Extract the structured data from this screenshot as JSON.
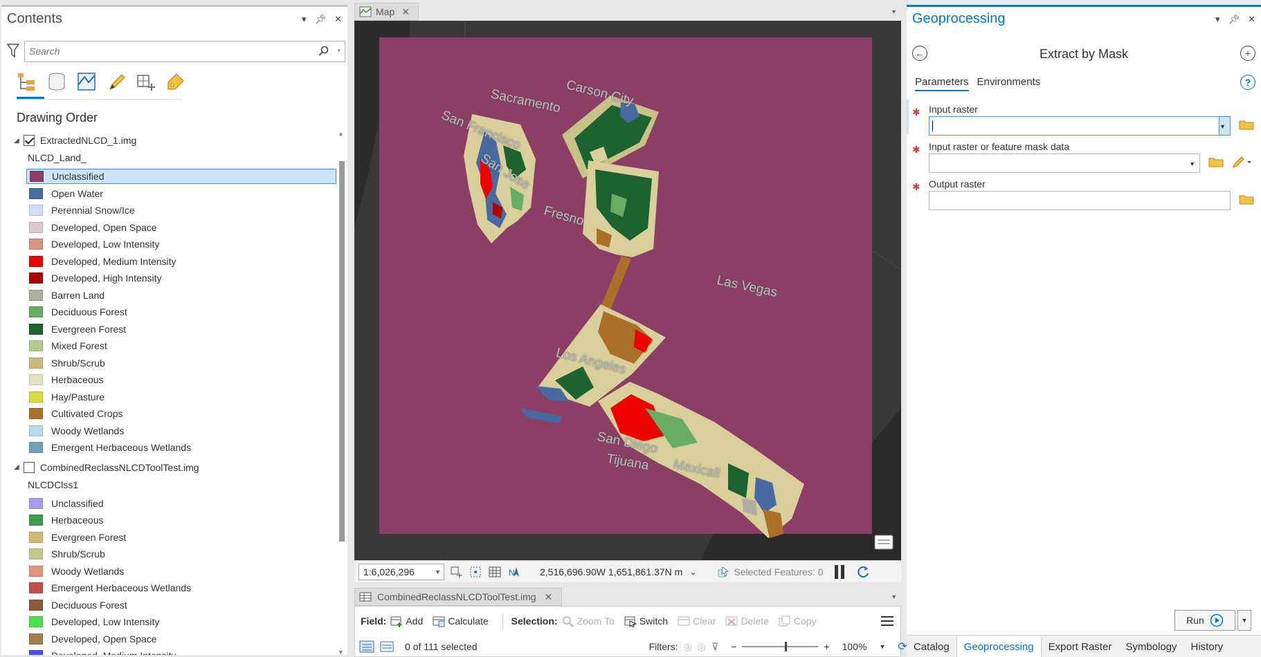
{
  "contents": {
    "title": "Contents",
    "search_placeholder": "Search",
    "section_title": "Drawing Order",
    "layer1": {
      "name": "ExtractedNLCD_1.img",
      "checked": true,
      "field": "NLCD_Land_",
      "classes": [
        {
          "label": "Unclassified",
          "color": "#8b3f65",
          "selected": true
        },
        {
          "label": "Open Water",
          "color": "#476ba1"
        },
        {
          "label": "Perennial Snow/Ice",
          "color": "#d1ddf9"
        },
        {
          "label": "Developed, Open Space",
          "color": "#ddc9c9"
        },
        {
          "label": "Developed, Low Intensity",
          "color": "#d89382"
        },
        {
          "label": "Developed, Medium Intensity",
          "color": "#ed0000"
        },
        {
          "label": "Developed, High Intensity",
          "color": "#aa0000"
        },
        {
          "label": "Barren Land",
          "color": "#b2ada3"
        },
        {
          "label": "Deciduous Forest",
          "color": "#68ab63"
        },
        {
          "label": "Evergreen Forest",
          "color": "#1c6330"
        },
        {
          "label": "Mixed Forest",
          "color": "#b5c98e"
        },
        {
          "label": "Shrub/Scrub",
          "color": "#ccba7d"
        },
        {
          "label": "Herbaceous",
          "color": "#e3e3c2"
        },
        {
          "label": "Hay/Pasture",
          "color": "#dcd93d"
        },
        {
          "label": "Cultivated Crops",
          "color": "#ab7028"
        },
        {
          "label": "Woody Wetlands",
          "color": "#bad9eb"
        },
        {
          "label": "Emergent Herbaceous Wetlands",
          "color": "#70a3ba"
        }
      ]
    },
    "layer2": {
      "name": "CombinedReclassNLCDToolTest.img",
      "checked": false,
      "field": "NLCDClss1",
      "classes": [
        {
          "label": "Unclassified",
          "color": "#a89ee8"
        },
        {
          "label": "Herbaceous",
          "color": "#3d9c50"
        },
        {
          "label": "Evergreen Forest",
          "color": "#d2b874"
        },
        {
          "label": "Shrub/Scrub",
          "color": "#c3c98a"
        },
        {
          "label": "Woody Wetlands",
          "color": "#e0967a"
        },
        {
          "label": "Emergent Herbaceous Wetlands",
          "color": "#c0504d"
        },
        {
          "label": "Deciduous Forest",
          "color": "#8b5a3c"
        },
        {
          "label": "Developed, Low Intensity",
          "color": "#4fe04f"
        },
        {
          "label": "Developed, Open Space",
          "color": "#a67c52"
        },
        {
          "label": "Developed, Medium Intensity",
          "color": "#4a4aff"
        }
      ]
    }
  },
  "map": {
    "tab_label": "Map",
    "labels": [
      "Sacramento",
      "Carson City",
      "San Francisco",
      "San Jose",
      "Fresno",
      "Las Vegas",
      "Los Angeles",
      "San Diego",
      "Tijuana",
      "Mexicali"
    ],
    "scale": "1:6,026,296",
    "coordinates": "2,516,696.90W 1,651,861.37N m",
    "selected_features": "Selected Features: 0",
    "extent_color": "#8b3f65"
  },
  "table": {
    "tab_label": "CombinedReclassNLCDToolTest.img",
    "field_label": "Field:",
    "add": "Add",
    "calculate": "Calculate",
    "selection_label": "Selection:",
    "zoom_to": "Zoom To",
    "switch": "Switch",
    "clear": "Clear",
    "delete": "Delete",
    "copy": "Copy",
    "selected_count": "0 of 111 selected",
    "filters_label": "Filters:",
    "zoom": "100%"
  },
  "geoprocessing": {
    "title": "Geoprocessing",
    "tool_name": "Extract by Mask",
    "tabs": [
      "Parameters",
      "Environments"
    ],
    "params": [
      {
        "label": "Input raster",
        "value": ""
      },
      {
        "label": "Input raster or feature mask data",
        "value": ""
      },
      {
        "label": "Output raster",
        "value": ""
      }
    ],
    "run_label": "Run",
    "bottom_tabs": [
      "Catalog",
      "Geoprocessing",
      "Export Raster",
      "Symbology",
      "History"
    ],
    "accent": "#0079c1"
  }
}
